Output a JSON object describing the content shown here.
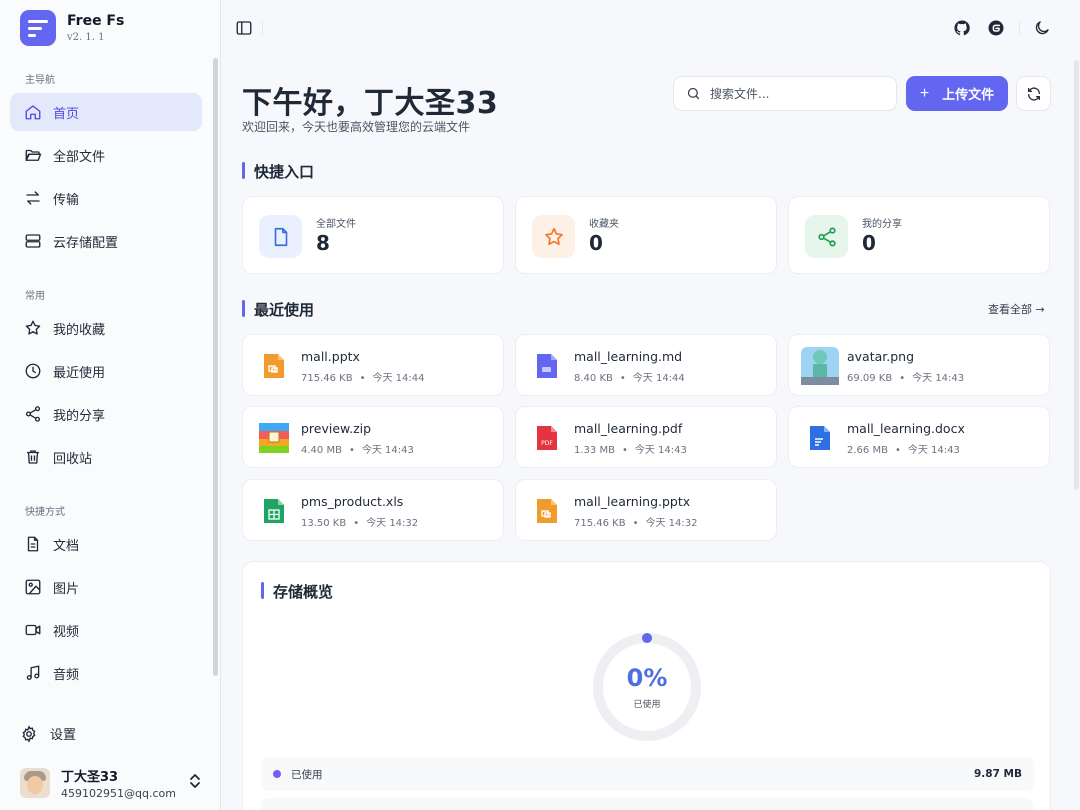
{
  "brand": {
    "name": "Free Fs",
    "version": "v2. 1. 1"
  },
  "sidebar": {
    "groups": [
      {
        "label": "主导航"
      },
      {
        "label": "常用"
      },
      {
        "label": "快捷方式"
      }
    ],
    "items": [
      {
        "label": "首页",
        "icon": "home-icon",
        "active": true
      },
      {
        "label": "全部文件",
        "icon": "folder-open-icon"
      },
      {
        "label": "传输",
        "icon": "transfer-icon"
      },
      {
        "label": "云存储配置",
        "icon": "server-icon"
      },
      {
        "label": "我的收藏",
        "icon": "star-icon"
      },
      {
        "label": "最近使用",
        "icon": "clock-icon"
      },
      {
        "label": "我的分享",
        "icon": "share-icon"
      },
      {
        "label": "回收站",
        "icon": "trash-icon"
      },
      {
        "label": "文档",
        "icon": "document-icon"
      },
      {
        "label": "图片",
        "icon": "image-icon"
      },
      {
        "label": "视频",
        "icon": "video-icon"
      },
      {
        "label": "音频",
        "icon": "music-icon"
      }
    ],
    "settings_label": "设置",
    "user": {
      "name": "丁大圣33",
      "email": "459102951@qq.com"
    }
  },
  "header": {
    "greeting": "下午好，丁大圣33",
    "subtitle": "欢迎回来，今天也要高效管理您的云端文件",
    "search_placeholder": "搜索文件...",
    "upload_label": "上传文件"
  },
  "quick": {
    "title": "快捷入口",
    "cards": [
      {
        "label": "全部文件",
        "value": "8",
        "icon": "file-icon",
        "color": "#3b6fe0",
        "bg": "#eaf0fd"
      },
      {
        "label": "收藏夹",
        "value": "0",
        "icon": "star-icon",
        "color": "#f0782a",
        "bg": "#fdf0e6"
      },
      {
        "label": "我的分享",
        "value": "0",
        "icon": "share-icon",
        "color": "#1f9d55",
        "bg": "#e6f6ec"
      }
    ]
  },
  "recent": {
    "title": "最近使用",
    "view_all": "查看全部 →",
    "files": [
      {
        "name": "mall.pptx",
        "size": "715.46 KB",
        "time": "今天 14:44",
        "type": "ppt"
      },
      {
        "name": "mall_learning.md",
        "size": "8.40 KB",
        "time": "今天 14:44",
        "type": "md"
      },
      {
        "name": "avatar.png",
        "size": "69.09 KB",
        "time": "今天 14:43",
        "type": "png"
      },
      {
        "name": "preview.zip",
        "size": "4.40 MB",
        "time": "今天 14:43",
        "type": "zip"
      },
      {
        "name": "mall_learning.pdf",
        "size": "1.33 MB",
        "time": "今天 14:43",
        "type": "pdf"
      },
      {
        "name": "mall_learning.docx",
        "size": "2.66 MB",
        "time": "今天 14:43",
        "type": "doc"
      },
      {
        "name": "pms_product.xls",
        "size": "13.50 KB",
        "time": "今天 14:32",
        "type": "xls"
      },
      {
        "name": "mall_learning.pptx",
        "size": "715.46 KB",
        "time": "今天 14:32",
        "type": "ppt"
      }
    ],
    "separator": "•"
  },
  "storage": {
    "title": "存储概览",
    "percent": "0%",
    "percent_label": "已使用",
    "used_label": "已使用",
    "used_value": "9.87 MB",
    "accent": "#6366f1"
  }
}
